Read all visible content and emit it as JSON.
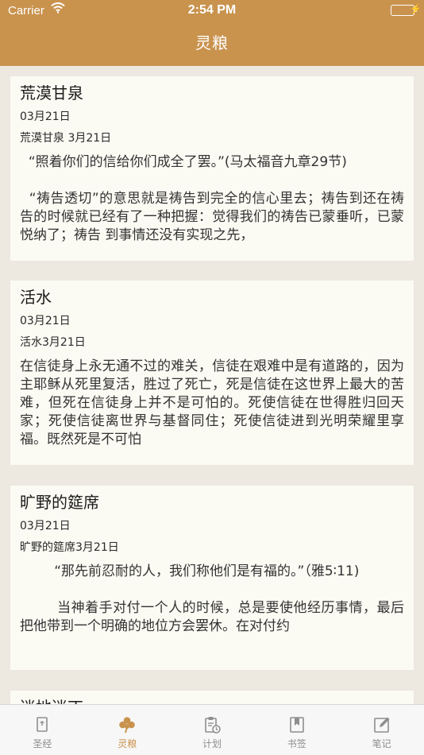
{
  "status_bar": {
    "carrier": "Carrier",
    "time": "2:54 PM"
  },
  "nav": {
    "title": "灵粮"
  },
  "cards": [
    {
      "title": "荒漠甘泉",
      "date": "03月21日",
      "subtitle": "荒漠甘泉 3月21日",
      "body": "  “照着你们的信给你们成全了罢。”(马太福音九章29节)\n\n  “祷告透切”的意思就是祷告到完全的信心里去；祷告到还在祷告的时候就已经有了一种把握：觉得我们的祷告已蒙垂听，已蒙悦纳了；祷告 到事情还没有实现之先，"
    },
    {
      "title": "活水",
      "date": "03月21日",
      "subtitle": "活水3月21日",
      "body": "在信徒身上永无通不过的难关，信徒在艰难中是有道路的，因为主耶稣从死里复活，胜过了死亡，死是信徒在这世界上最大的苦难，但死在信徒身上并不是可怕的。死使信徒在世得胜归回天家；死使信徒离世界与基督同住；死使信徒进到光明荣耀里享福。既然死是不可怕"
    },
    {
      "title": "旷野的筵席",
      "date": "03月21日",
      "subtitle": "旷野的筵席3月21日",
      "body": "        “那先前忍耐的人，我们称他们是有福的。”（雅5∶11)\n\n        当神着手对付一个人的时候，总是要使他经历事情，最后把他带到一个明确的地位方会罢休。在对付约"
    },
    {
      "title": "迷地迷丁"
    }
  ],
  "tabs": [
    {
      "label": "圣经",
      "icon": "bible-icon",
      "active": false
    },
    {
      "label": "灵粮",
      "icon": "clover-icon",
      "active": true
    },
    {
      "label": "计划",
      "icon": "clipboard-clock-icon",
      "active": false
    },
    {
      "label": "书签",
      "icon": "bookmark-icon",
      "active": false
    },
    {
      "label": "笔记",
      "icon": "note-edit-icon",
      "active": false
    }
  ],
  "colors": {
    "accent": "#c9934e",
    "background": "#ede9e0",
    "card": "#fbfaf3",
    "tab_inactive": "#8e8e8e",
    "battery": "#4cd964"
  }
}
